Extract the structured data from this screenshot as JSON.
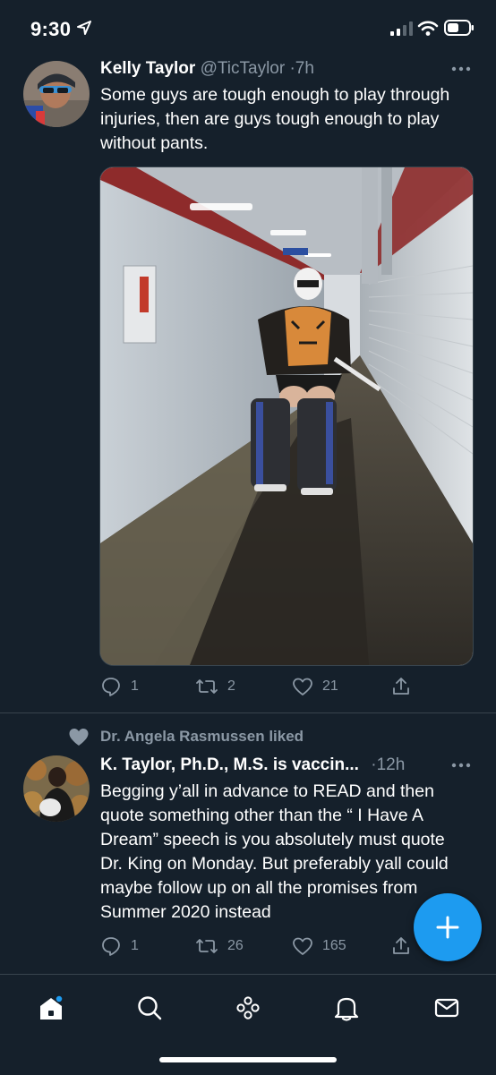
{
  "status_bar": {
    "time": "9:30"
  },
  "tweet1": {
    "name": "Kelly Taylor",
    "handle": "@TicTaylor",
    "separator": "·",
    "time": "7h",
    "text": "Some guys are tough enough to play through injuries, then are guys tough enough to play without pants.",
    "actions": {
      "replies": "1",
      "retweets": "2",
      "likes": "21"
    }
  },
  "tweet2": {
    "social_context": "Dr. Angela Rasmussen liked",
    "name": "K. Taylor, Ph.D., M.S. is vaccin...",
    "separator": "·",
    "time": "12h",
    "text": "Begging y’all in advance to READ and then quote something other than the “ I Have A Dream” speech is you absolutely must quote Dr. King on Monday. But preferably yall could maybe follow up on all the promises from Summer 2020 instead",
    "actions": {
      "replies": "1",
      "retweets": "26",
      "likes": "165"
    }
  },
  "nav": {
    "tabs": [
      "home-icon",
      "search-icon",
      "spaces-icon",
      "notifications-icon",
      "messages-icon"
    ]
  },
  "colors": {
    "background": "#15202b",
    "secondary_text": "#8b98a5",
    "accent": "#1d9bf0"
  }
}
